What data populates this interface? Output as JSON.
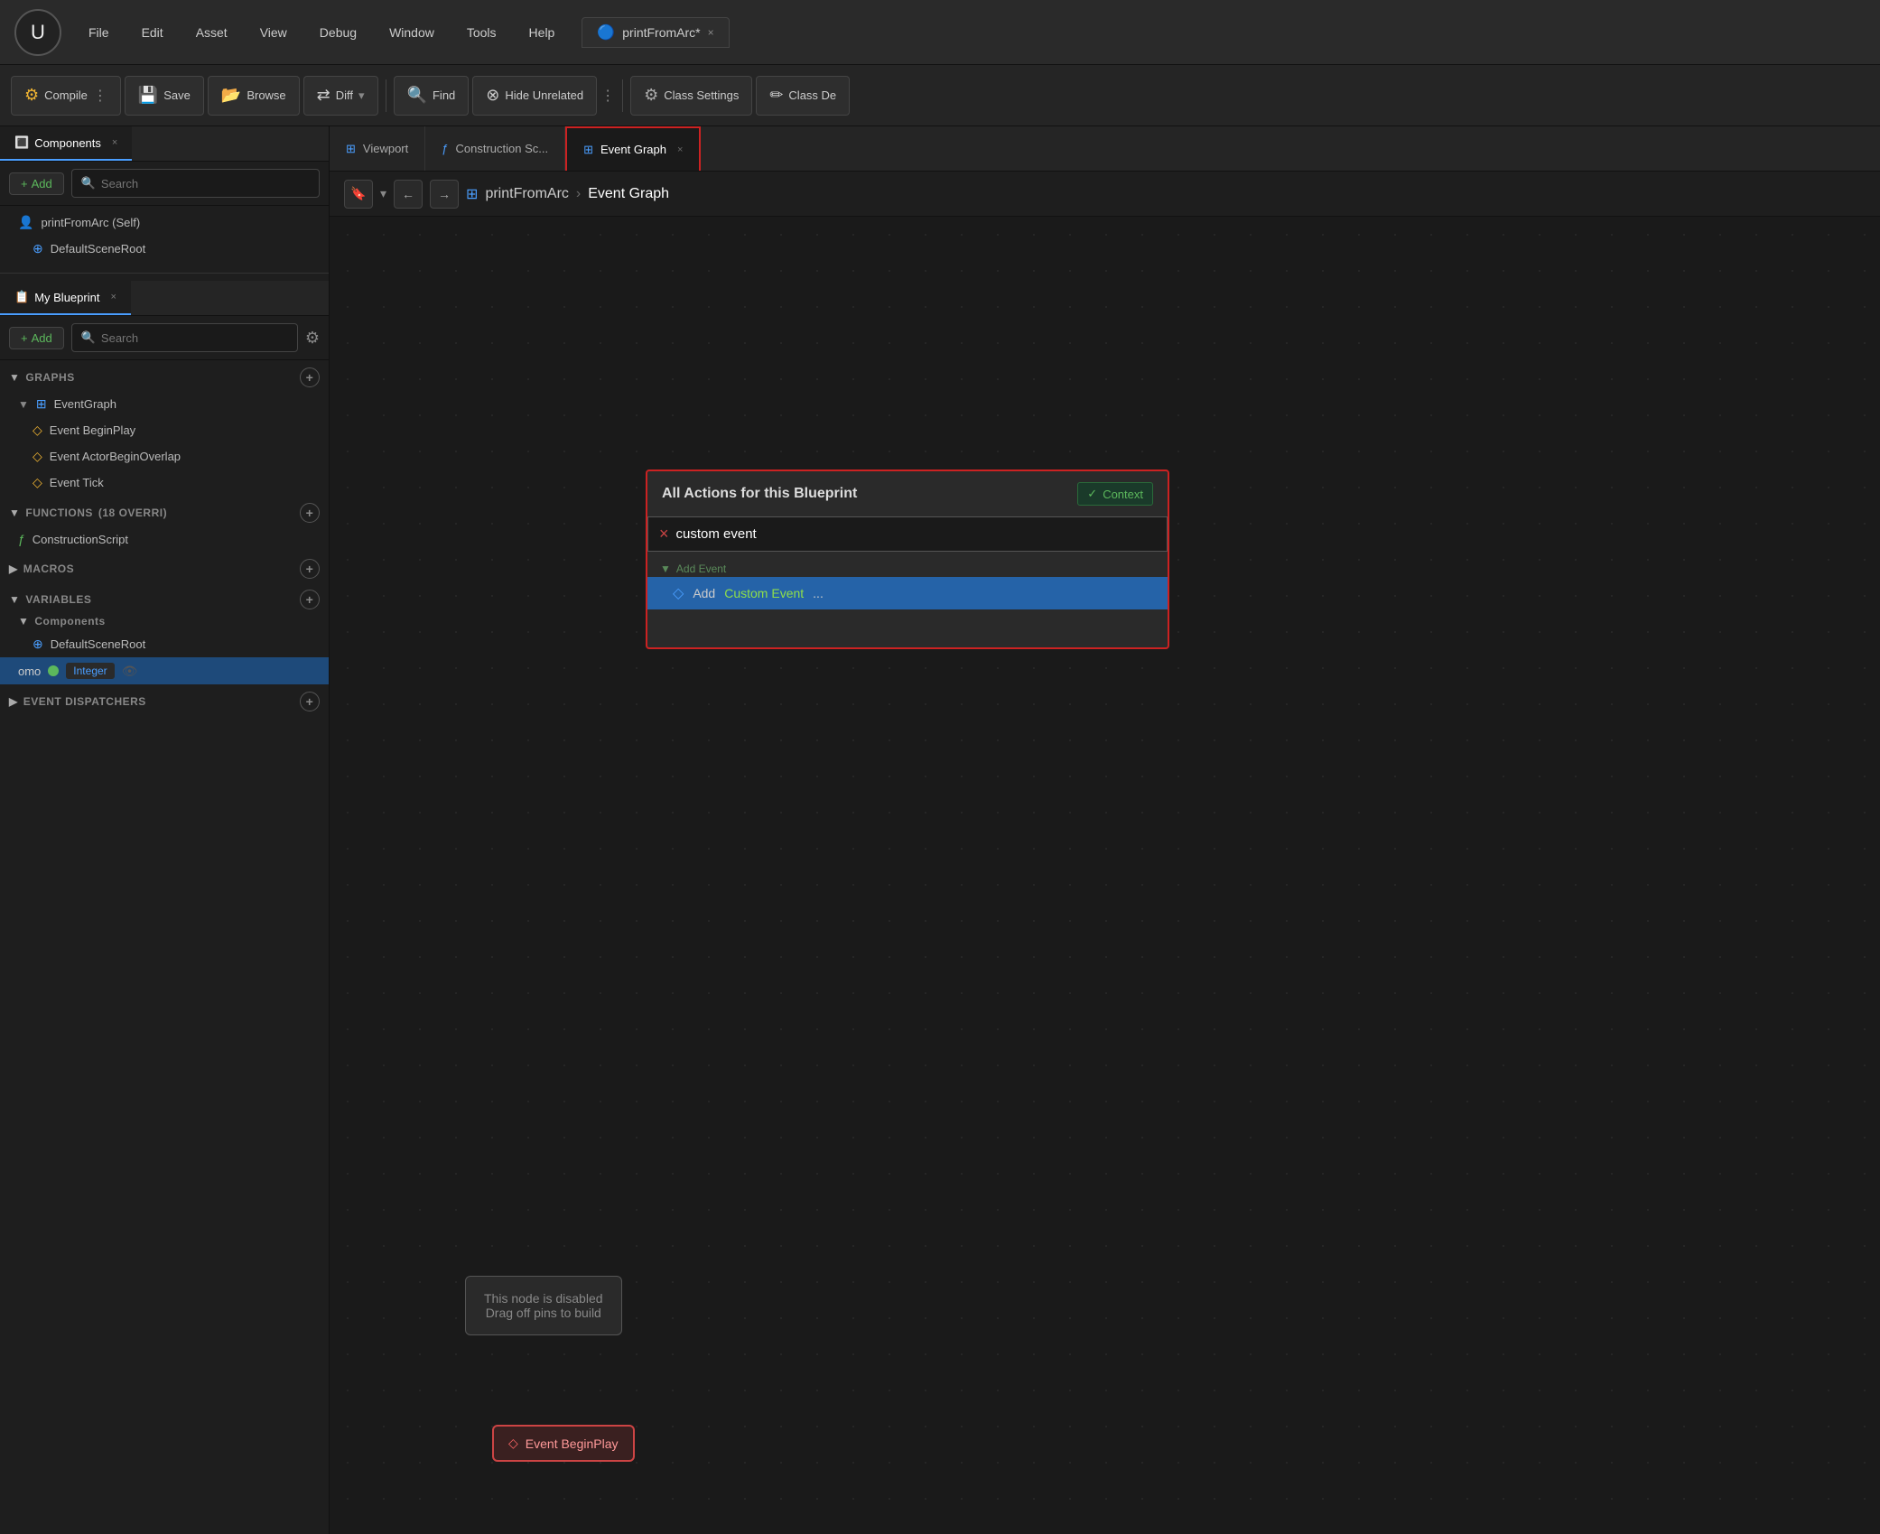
{
  "titlebar": {
    "logo": "U",
    "tab_label": "printFromArc*",
    "tab_close": "×",
    "menus": [
      "File",
      "Edit",
      "Asset",
      "View",
      "Debug",
      "Window",
      "Tools",
      "Help"
    ]
  },
  "toolbar": {
    "compile_label": "Compile",
    "save_label": "Save",
    "browse_label": "Browse",
    "diff_label": "Diff",
    "find_label": "Find",
    "hide_unrelated_label": "Hide Unrelated",
    "class_settings_label": "Class Settings",
    "class_defaults_label": "Class De"
  },
  "components_panel": {
    "title": "Components",
    "close": "×",
    "add_label": "+ Add",
    "search_placeholder": "Search",
    "tree": [
      {
        "label": "printFromArc (Self)",
        "indent": 0,
        "icon": "👤"
      },
      {
        "label": "DefaultSceneRoot",
        "indent": 1,
        "icon": "⊕"
      }
    ]
  },
  "blueprint_panel": {
    "title": "My Blueprint",
    "close": "×",
    "add_label": "+ Add",
    "search_placeholder": "Search",
    "sections": {
      "graphs": {
        "label": "GRAPHS",
        "items": [
          {
            "label": "EventGraph",
            "children": [
              {
                "label": "Event BeginPlay",
                "icon": "◇"
              },
              {
                "label": "Event ActorBeginOverlap",
                "icon": "◇"
              },
              {
                "label": "Event Tick",
                "icon": "◇"
              }
            ]
          }
        ]
      },
      "functions": {
        "label": "FUNCTIONS",
        "badge": "(18 OVERRI)",
        "items": [
          {
            "label": "ConstructionScript",
            "icon": "ƒ"
          }
        ]
      },
      "macros": {
        "label": "MACROS"
      },
      "variables": {
        "label": "VARIABLES",
        "subsections": [
          {
            "label": "Components",
            "items": [
              {
                "label": "DefaultSceneRoot",
                "icon": "⊕"
              }
            ]
          },
          {
            "label": "omo",
            "type": "Integer",
            "selected": true
          }
        ]
      },
      "event_dispatchers": {
        "label": "EVENT DISPATCHERS"
      }
    }
  },
  "editor_tabs": [
    {
      "label": "Viewport",
      "icon": "⊞",
      "active": false
    },
    {
      "label": "Construction Sc...",
      "icon": "ƒ",
      "active": false
    },
    {
      "label": "Event Graph",
      "icon": "⊞",
      "active": true,
      "closeable": true
    }
  ],
  "breadcrumb": {
    "class_name": "printFromArc",
    "current": "Event Graph"
  },
  "popup": {
    "title": "All Actions for this Blueprint",
    "context_label": "Context",
    "search_value": "custom event",
    "clear_icon": "×",
    "sections": [
      {
        "label": "▼ Add Event",
        "items": [
          {
            "icon": "◇",
            "prefix": "Add ",
            "highlight": "Custom Event",
            "suffix": "..."
          }
        ]
      }
    ]
  },
  "canvas": {
    "node_disabled_text": "This node is disabled\nDrag off pins to build",
    "node_begin_play": "Event BeginPlay"
  },
  "colors": {
    "accent_red": "#cc2222",
    "accent_blue": "#4a9eff",
    "accent_green": "#5cb85c",
    "accent_yellow": "#f0b432",
    "tab_active_border": "#e05252"
  }
}
